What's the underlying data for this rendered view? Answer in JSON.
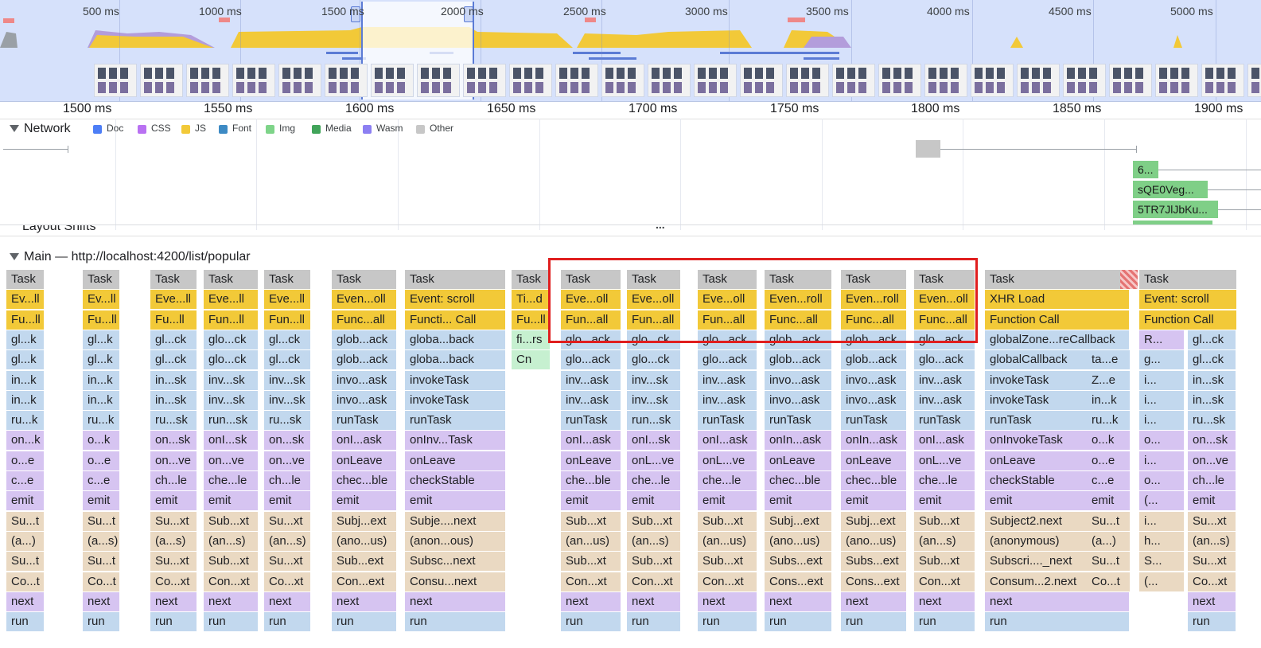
{
  "overview": {
    "ticks": [
      "500 ms",
      "1000 ms",
      "1500 ms",
      "2000 ms",
      "2500 ms",
      "3000 ms",
      "3500 ms",
      "4000 ms",
      "4500 ms",
      "5000 ms"
    ]
  },
  "ruler": {
    "ticks": [
      "1500 ms",
      "1550 ms",
      "1600 ms",
      "1650 ms",
      "1700 ms",
      "1750 ms",
      "1800 ms",
      "1850 ms",
      "1900 ms"
    ]
  },
  "network": {
    "title": "Network",
    "legend": [
      {
        "label": "Doc",
        "color": "#4d7ef6"
      },
      {
        "label": "CSS",
        "color": "#b971f2"
      },
      {
        "label": "JS",
        "color": "#f2c938"
      },
      {
        "label": "Font",
        "color": "#3d8ac4"
      },
      {
        "label": "Img",
        "color": "#7ed489"
      },
      {
        "label": "Media",
        "color": "#41a45a"
      },
      {
        "label": "Wasm",
        "color": "#8c7ff2"
      },
      {
        "label": "Other",
        "color": "#c7c7c7"
      }
    ],
    "requests": [
      "6...",
      "sQE0Veg...",
      "5TR7JlJbKu..."
    ]
  },
  "layout_shifts": "Layout Shifts",
  "main": {
    "title": "Main — http://localhost:4200/list/popular",
    "more_indicator": "...",
    "columns": [
      {
        "rows": [
          "Task",
          "Ev...ll",
          "Fu...ll",
          "gl...k",
          "gl...k",
          "in...k",
          "in...k",
          "ru...k",
          "on...k",
          "o...e",
          "c...e",
          "emit",
          "Su...t",
          "(a...)",
          "Su...t",
          "Co...t",
          "next",
          "run"
        ]
      },
      {
        "rows": [
          "Task",
          "Ev...ll",
          "Fu...ll",
          "gl...k",
          "gl...k",
          "in...k",
          "in...k",
          "ru...k",
          "o...k",
          "o...e",
          "c...e",
          "emit",
          "Su...t",
          "(a...s)",
          "Su...t",
          "Co...t",
          "next",
          "run"
        ]
      },
      {
        "rows": [
          "Task",
          "Eve...ll",
          "Fu...ll",
          "gl...ck",
          "gl...ck",
          "in...sk",
          "in...sk",
          "ru...sk",
          "on...sk",
          "on...ve",
          "ch...le",
          "emit",
          "Su...xt",
          "(a...s)",
          "Su...xt",
          "Co...xt",
          "next",
          "run"
        ]
      },
      {
        "rows": [
          "Task",
          "Eve...ll",
          "Fun...ll",
          "glo...ck",
          "glo...ck",
          "inv...sk",
          "inv...sk",
          "run...sk",
          "onI...sk",
          "on...ve",
          "che...le",
          "emit",
          "Sub...xt",
          "(an...s)",
          "Sub...xt",
          "Con...xt",
          "next",
          "run"
        ]
      },
      {
        "rows": [
          "Task",
          "Eve...ll",
          "Fun...ll",
          "gl...ck",
          "gl...ck",
          "inv...sk",
          "inv...sk",
          "ru...sk",
          "on...sk",
          "on...ve",
          "ch...le",
          "emit",
          "Su...xt",
          "(an...s)",
          "Su...xt",
          "Co...xt",
          "next",
          "run"
        ]
      },
      {
        "rows": [
          "Task",
          "Even...oll",
          "Func...all",
          "glob...ack",
          "glob...ack",
          "invo...ask",
          "invo...ask",
          "runTask",
          "onI...ask",
          "onLeave",
          "chec...ble",
          "emit",
          "Subj...ext",
          "(ano...us)",
          "Sub...ext",
          "Con...ext",
          "next",
          "run"
        ]
      },
      {
        "rows": [
          "Task",
          "Event: scroll",
          "Functi... Call",
          "globa...back",
          "globa...back",
          "invokeTask",
          "invokeTask",
          "runTask",
          "onInv...Task",
          "onLeave",
          "checkStable",
          "emit",
          "Subje....next",
          "(anon...ous)",
          "Subsc...next",
          "Consu...next",
          "next",
          "run"
        ]
      },
      {
        "rows": [
          "Task",
          "Ti...d",
          "Fu...ll",
          "fi...rs",
          "Cn"
        ]
      },
      {
        "rows": [
          "Task",
          "Eve...oll",
          "Fun...all",
          "glo...ack",
          "glo...ack",
          "inv...ask",
          "inv...ask",
          "runTask",
          "onI...ask",
          "onLeave",
          "che...ble",
          "emit",
          "Sub...xt",
          "(an...us)",
          "Sub...xt",
          "Con...xt",
          "next",
          "run"
        ]
      },
      {
        "rows": [
          "Task",
          "Eve...oll",
          "Fun...all",
          "glo...ck",
          "glo...ck",
          "inv...sk",
          "inv...sk",
          "run...sk",
          "onI...sk",
          "onL...ve",
          "che...le",
          "emit",
          "Sub...xt",
          "(an...s)",
          "Sub...xt",
          "Con...xt",
          "next",
          "run"
        ]
      },
      {
        "rows": [
          "Task",
          "Eve...oll",
          "Fun...all",
          "glo...ack",
          "glo...ack",
          "inv...ask",
          "inv...ask",
          "runTask",
          "onI...ask",
          "onL...ve",
          "che...le",
          "emit",
          "Sub...xt",
          "(an...us)",
          "Sub...xt",
          "Con...xt",
          "next",
          "run"
        ]
      },
      {
        "rows": [
          "Task",
          "Even...roll",
          "Func...all",
          "glob...ack",
          "glob...ack",
          "invo...ask",
          "invo...ask",
          "runTask",
          "onIn...ask",
          "onLeave",
          "chec...ble",
          "emit",
          "Subj...ext",
          "(ano...us)",
          "Subs...ext",
          "Cons...ext",
          "next",
          "run"
        ]
      },
      {
        "rows": [
          "Task",
          "Even...roll",
          "Func...all",
          "glob...ack",
          "glob...ack",
          "invo...ask",
          "invo...ask",
          "runTask",
          "onIn...ask",
          "onLeave",
          "chec...ble",
          "emit",
          "Subj...ext",
          "(ano...us)",
          "Subs...ext",
          "Cons...ext",
          "next",
          "run"
        ]
      },
      {
        "rows": [
          "Task",
          "Even...oll",
          "Func...all",
          "glo...ack",
          "glo...ack",
          "inv...ask",
          "inv...ask",
          "runTask",
          "onI...ask",
          "onL...ve",
          "che...le",
          "emit",
          "Sub...xt",
          "(an...s)",
          "Sub...xt",
          "Con...xt",
          "next",
          "run"
        ]
      },
      {
        "rows": [
          "Task",
          "XHR Load",
          "Function Call",
          "globalZone...reCallback",
          "globalCallback",
          "invokeTask",
          "invokeTask",
          "runTask",
          "onInvokeTask",
          "onLeave",
          "checkStable",
          "emit",
          "Subject2.next",
          "(anonymous)",
          "Subscri...._next",
          "Consum...2.next",
          "next",
          "run"
        ]
      },
      {
        "rows": [
          "ta...e",
          "Z...e",
          "in...k",
          "ru...k",
          "o...k",
          "o...e",
          "c...e",
          "emit",
          "Su...t",
          "(a...)",
          "Su...t",
          "Co...t"
        ]
      },
      {
        "rows": [
          "Task",
          "Event: scroll",
          "Function Call",
          "R...",
          "g...",
          "i...",
          "i...",
          "i...",
          "o...",
          "i...",
          "o...",
          "(...",
          "i...",
          "h...",
          "S...",
          "(..."
        ]
      },
      {
        "rows": [
          "gl...ck",
          "gl...ck",
          "in...sk",
          "in...sk",
          "ru...sk",
          "on...sk",
          "on...ve",
          "ch...le",
          "emit",
          "Su...xt",
          "(an...s)",
          "Su...xt",
          "Co...xt",
          "next",
          "run"
        ]
      }
    ]
  }
}
